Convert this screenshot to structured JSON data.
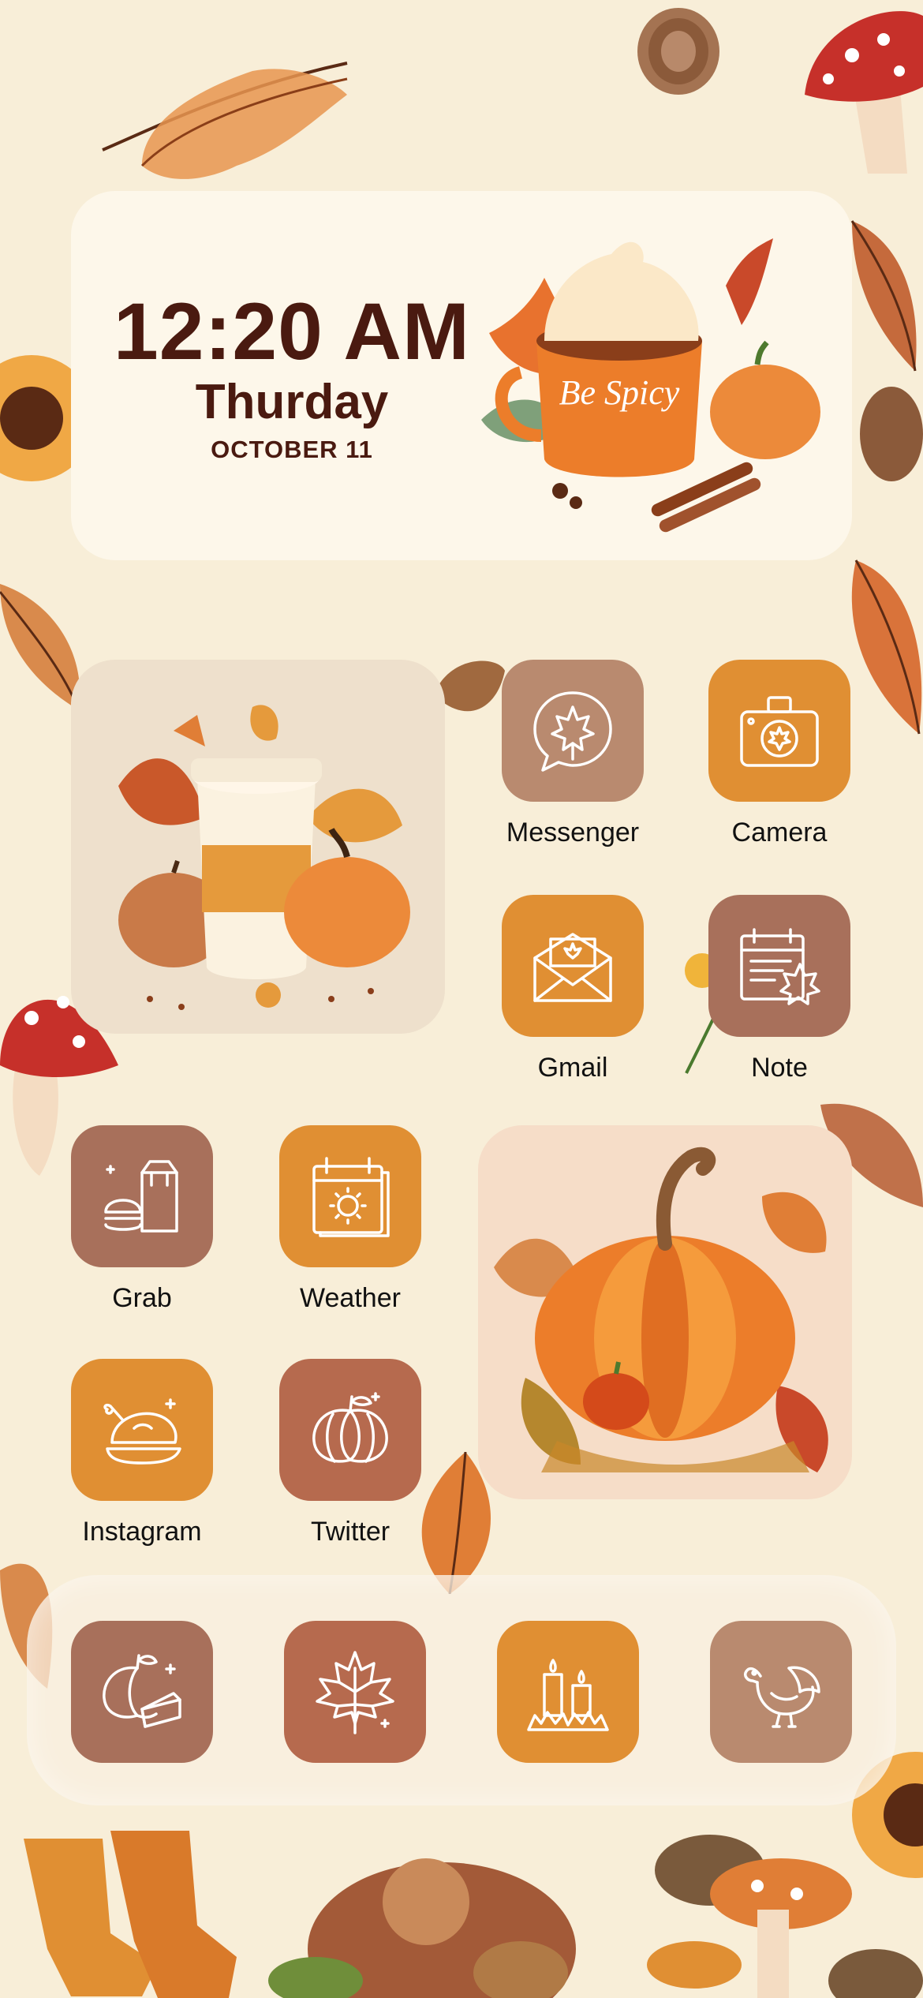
{
  "time_widget": {
    "time": "12:20 AM",
    "day": "Thurday",
    "date": "OCTOBER 11",
    "mug_text": "Be Spicy"
  },
  "apps": [
    {
      "label": "Messenger",
      "icon": "maple-leaf-chat-icon",
      "color": "#b98a6f"
    },
    {
      "label": "Camera",
      "icon": "camera-icon",
      "color": "#e08f33"
    },
    {
      "label": "Gmail",
      "icon": "envelope-icon",
      "color": "#e08f33"
    },
    {
      "label": "Note",
      "icon": "calendar-leaf-icon",
      "color": "#a8705b"
    },
    {
      "label": "Grab",
      "icon": "burger-bag-icon",
      "color": "#a8705b"
    },
    {
      "label": "Weather",
      "icon": "sun-calendar-icon",
      "color": "#e08f33"
    },
    {
      "label": "Instagram",
      "icon": "roast-turkey-icon",
      "color": "#e08f33"
    },
    {
      "label": "Twitter",
      "icon": "pumpkin-icon",
      "color": "#b66a4e"
    }
  ],
  "dock": [
    {
      "icon": "pumpkin-pie-icon",
      "color": "#a8705b"
    },
    {
      "icon": "maple-leaf-icon",
      "color": "#b66a4e"
    },
    {
      "icon": "candles-icon",
      "color": "#e08f33"
    },
    {
      "icon": "turkey-icon",
      "color": "#b98a6f"
    }
  ],
  "widgets": [
    {
      "name": "latte-pumpkin-widget"
    },
    {
      "name": "pumpkin-leaves-widget"
    }
  ]
}
